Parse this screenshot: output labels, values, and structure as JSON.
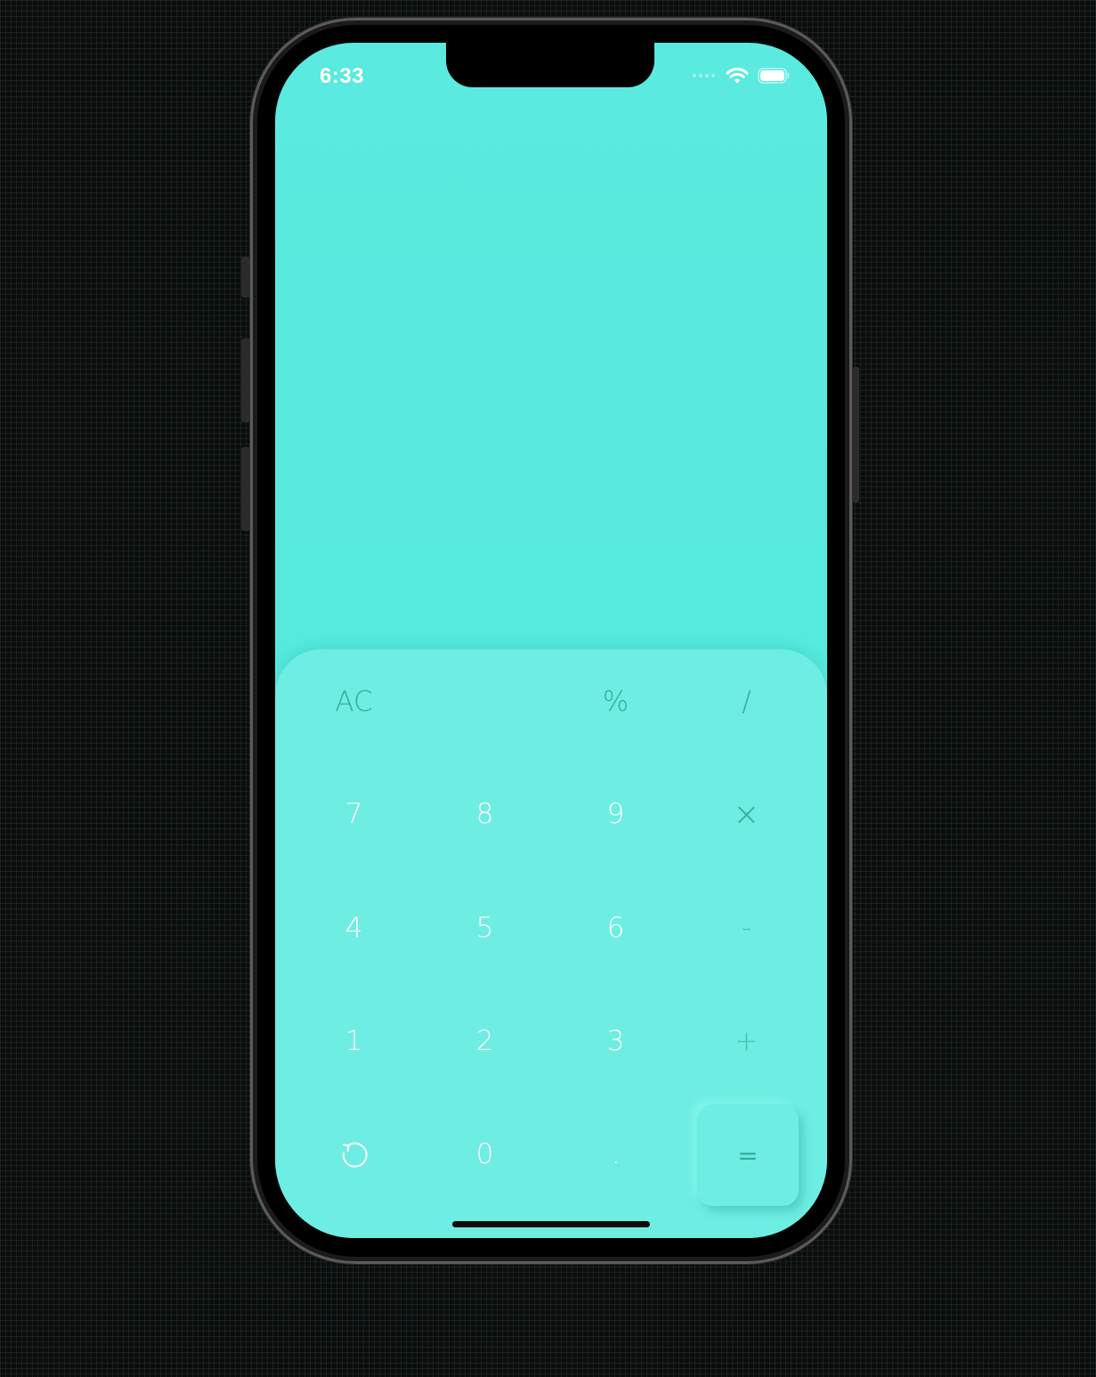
{
  "status_bar": {
    "time": "6:33",
    "wifi_icon": "wifi-icon",
    "battery_icon": "battery-icon"
  },
  "display": {
    "value": ""
  },
  "keypad": {
    "row1": {
      "clear": "AC",
      "percent": "%",
      "divide": "/"
    },
    "row2": {
      "seven": "7",
      "eight": "8",
      "nine": "9",
      "multiply": "×"
    },
    "row3": {
      "four": "4",
      "five": "5",
      "six": "6",
      "minus": "-"
    },
    "row4": {
      "one": "1",
      "two": "2",
      "three": "3",
      "plus": "+"
    },
    "row5": {
      "undo_icon": "undo-icon",
      "zero": "0",
      "decimal": ".",
      "equals": "="
    }
  },
  "colors": {
    "screen_background": "#55e9dd",
    "keypad_background": "#6eede2",
    "operator_text": "#3aa99f",
    "digit_text": "#ffffff"
  }
}
